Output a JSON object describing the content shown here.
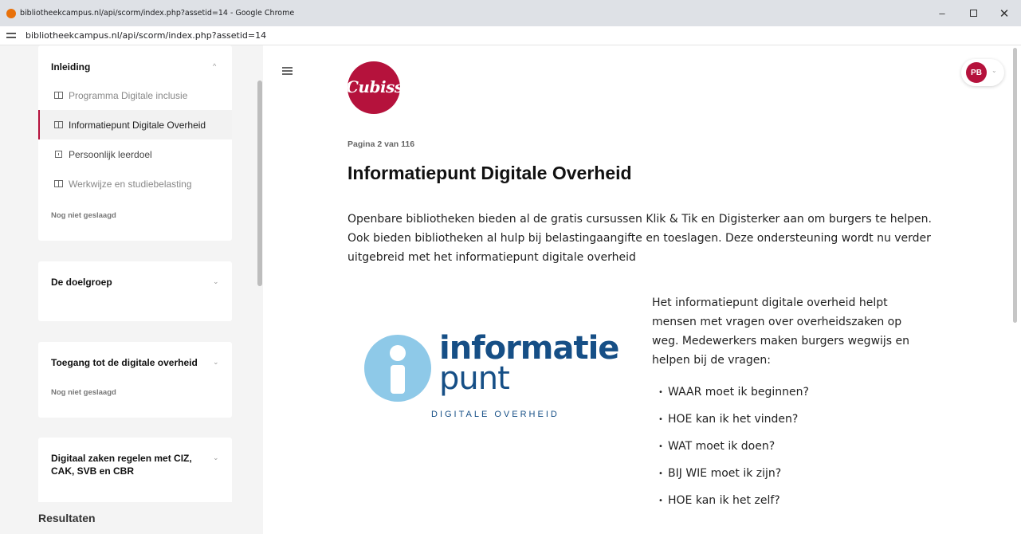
{
  "browser": {
    "window_title": "bibliotheekcampus.nl/api/scorm/index.php?assetid=14 - Google Chrome",
    "url": "bibliotheekcampus.nl/api/scorm/index.php?assetid=14",
    "controls": {
      "minimize": "–",
      "close": "✕"
    }
  },
  "sidebar": {
    "sections": [
      {
        "title": "Inleiding",
        "chevron": "^",
        "lessons": [
          {
            "label": "Programma Digitale inclusie",
            "icon": "book-icon"
          },
          {
            "label": "Informatiepunt Digitale Overheid",
            "icon": "book-icon",
            "active": true
          },
          {
            "label": "Persoonlijk leerdoel",
            "icon": "note-icon"
          },
          {
            "label": "Werkwijze en studiebelasting",
            "icon": "book-icon"
          }
        ],
        "status": "Nog niet geslaagd"
      },
      {
        "title": "De doelgroep",
        "chevron": "⌄"
      },
      {
        "title": "Toegang tot de digitale overheid",
        "chevron": "⌄",
        "status": "Nog niet geslaagd"
      },
      {
        "title": "Digitaal zaken regelen met CIZ, CAK, SVB en CBR",
        "chevron": "⌄"
      }
    ],
    "results_label": "Resultaten"
  },
  "main": {
    "logo_text": "Cubiss",
    "avatar_initials": "PB",
    "avatar_chevron": "⌄",
    "page_indicator": "Pagina 2 van 116",
    "title": "Informatiepunt Digitale Overheid",
    "intro": "Openbare bibliotheken bieden al de gratis cursussen Klik & Tik en Digisterker aan om burgers te helpen. Ook bieden bibliotheken al hulp bij belastingaangifte en toeslagen. Deze ondersteuning wordt nu verder uitgebreid met het informatiepunt digitale overheid",
    "image_logo": {
      "word1": "informatie",
      "word2": "punt",
      "subtitle": "DIGITALE OVERHEID"
    },
    "side_text": "Het informatiepunt digitale overheid helpt mensen met vragen over overheidszaken op weg. Medewerkers maken burgers wegwijs en helpen bij de vragen:",
    "questions": [
      "WAAR moet ik beginnen?",
      "HOE kan ik het vinden?",
      "WAT moet ik doen?",
      "BIJ WIE moet ik zijn?",
      "HOE  kan ik het zelf?"
    ]
  },
  "colors": {
    "accent": "#b5123c",
    "logo_blue": "#164f86",
    "logo_light_blue": "#8ec9e8"
  }
}
